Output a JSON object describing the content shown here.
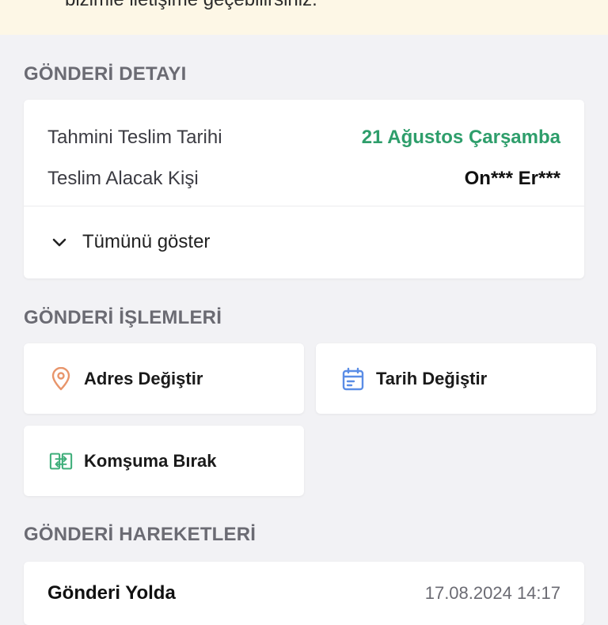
{
  "banner": {
    "text": "bizimle iletişime geçebilirsiniz."
  },
  "shipment_detail": {
    "title": "GÖNDERİ DETAYI",
    "estimated_delivery_label": "Tahmini Teslim Tarihi",
    "estimated_delivery_value": "21 Ağustos Çarşamba",
    "recipient_label": "Teslim Alacak Kişi",
    "recipient_value": "On*** Er***",
    "show_all_label": "Tümünü göster"
  },
  "shipment_actions": {
    "title": "GÖNDERİ İŞLEMLERİ",
    "change_address": "Adres Değiştir",
    "change_date": "Tarih Değiştir",
    "leave_with_neighbor": "Komşuma Bırak"
  },
  "shipment_movements": {
    "title": "GÖNDERİ HAREKETLERİ",
    "items": [
      {
        "status": "Gönderi Yolda",
        "datetime": "17.08.2024 14:17"
      }
    ]
  },
  "colors": {
    "accent_green": "#2e9e6b",
    "address_icon": "#e8956b",
    "date_icon": "#5a8de6",
    "neighbor_icon": "#3fae7a"
  },
  "icons": {
    "address": "location-pin-icon",
    "date": "calendar-icon",
    "neighbor": "swap-box-icon",
    "expand": "chevron-down-icon"
  }
}
